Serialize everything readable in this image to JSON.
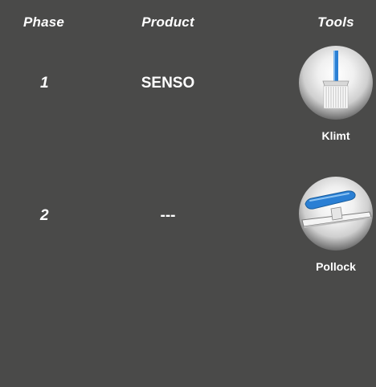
{
  "headers": {
    "phase": "Phase",
    "product": "Product",
    "tools": "Tools"
  },
  "rows": [
    {
      "phase": "1",
      "product": "SENSO",
      "tool_label": "Klimt",
      "tool_icon": "brush-icon"
    },
    {
      "phase": "2",
      "product": "---",
      "tool_label": "Pollock",
      "tool_icon": "spreader-icon"
    }
  ],
  "colors": {
    "background": "#4a4a49",
    "text": "#ffffff",
    "tool_accent": "#2a7fd4"
  }
}
